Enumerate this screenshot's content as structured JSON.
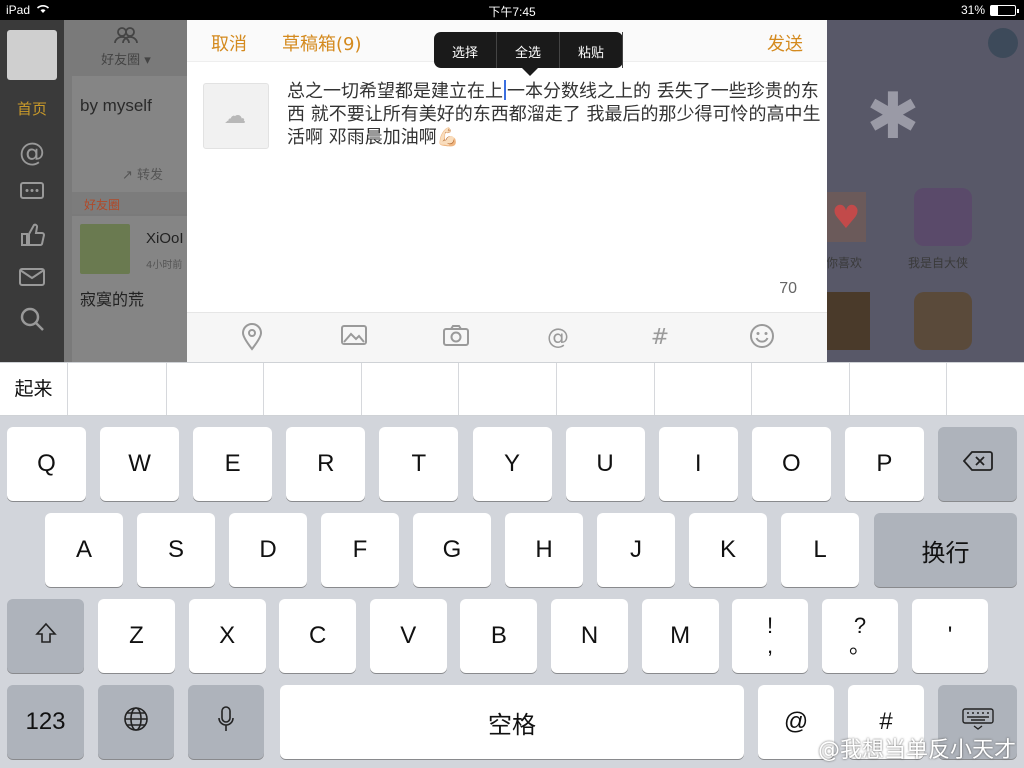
{
  "status": {
    "device": "iPad",
    "time": "下午7:45",
    "battery": "31%",
    "battery_level": 0.31
  },
  "background": {
    "nav": {
      "home": "首页"
    },
    "feed": {
      "groups_label": "好友圈 ▾",
      "card1_text": "by myself",
      "card1_forward": "转发",
      "section_label": "好友圈",
      "card2_name": "XiOoI",
      "card2_time": "4小时前",
      "card2_text": "寂寞的荒"
    },
    "right": {
      "label1": "你喜欢",
      "label2": "我是自大侠"
    }
  },
  "compose": {
    "cancel": "取消",
    "drafts": "草稿箱(9)",
    "send": "发送",
    "edit_menu": {
      "select": "选择",
      "select_all": "全选",
      "paste": "粘贴"
    },
    "text_before_cursor": "总之一切希望都是建立在上",
    "text_after_cursor": "一本分数线之上的 丢失了一些珍贵的东西 就不要让所有美好的东西都溜走了 我最后的那少得可怜的高中生活啊 邓雨晨加油啊💪🏻",
    "char_count": "70",
    "toolbar": [
      "location-icon",
      "image-icon",
      "camera-icon",
      "mention-icon",
      "topic-icon",
      "emoji-icon"
    ]
  },
  "keyboard": {
    "candidate": "起来",
    "row1": [
      "Q",
      "W",
      "E",
      "R",
      "T",
      "Y",
      "U",
      "I",
      "O",
      "P"
    ],
    "row2": [
      "A",
      "S",
      "D",
      "F",
      "G",
      "H",
      "J",
      "K",
      "L"
    ],
    "return": "换行",
    "row3": [
      "Z",
      "X",
      "C",
      "V",
      "B",
      "N",
      "M"
    ],
    "punct1_top": "!",
    "punct1_bottom": ",",
    "punct2_top": "?",
    "punct2_bottom": "。",
    "punct3": "'",
    "num": "123",
    "space": "空格",
    "at": "@",
    "hash": "#"
  },
  "watermark": "@我想当单反小天才"
}
